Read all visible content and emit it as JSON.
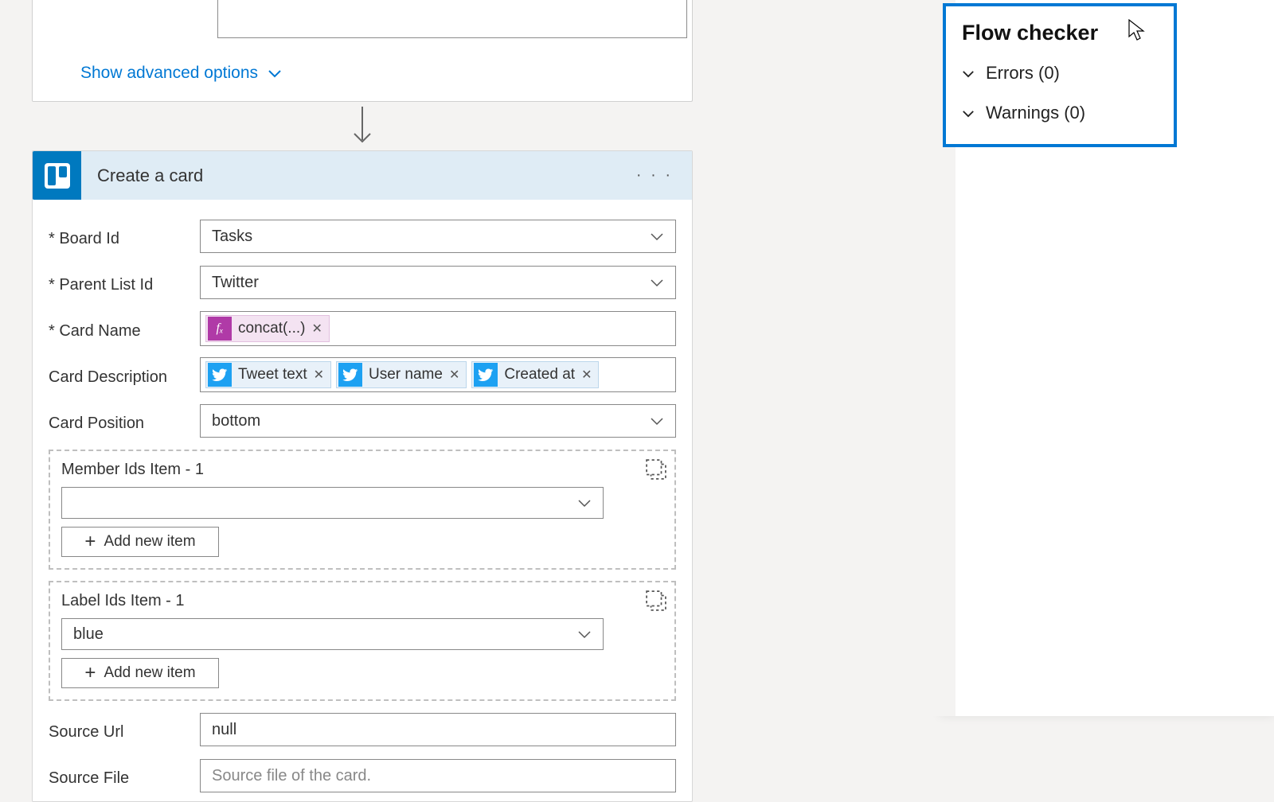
{
  "prev_action": {
    "advanced_link": "Show advanced options"
  },
  "action": {
    "title": "Create a card",
    "fields": {
      "board_id": {
        "label": "Board Id",
        "value": "Tasks"
      },
      "parent_list_id": {
        "label": "Parent List Id",
        "value": "Twitter"
      },
      "card_name": {
        "label": "Card Name",
        "token_label": "concat(...)"
      },
      "card_description": {
        "label": "Card Description",
        "tokens": [
          "Tweet text",
          "User name",
          "Created at"
        ]
      },
      "card_position": {
        "label": "Card Position",
        "value": "bottom"
      },
      "member_ids": {
        "label": "Member Ids Item - 1",
        "value": "",
        "add_label": "Add new item"
      },
      "label_ids": {
        "label": "Label Ids Item - 1",
        "value": "blue",
        "add_label": "Add new item"
      },
      "source_url": {
        "label": "Source Url",
        "value": "null"
      },
      "source_file": {
        "label": "Source File",
        "placeholder": "Source file of the card."
      }
    }
  },
  "flow_checker": {
    "title": "Flow checker",
    "errors_label": "Errors (0)",
    "warnings_label": "Warnings (0)"
  }
}
